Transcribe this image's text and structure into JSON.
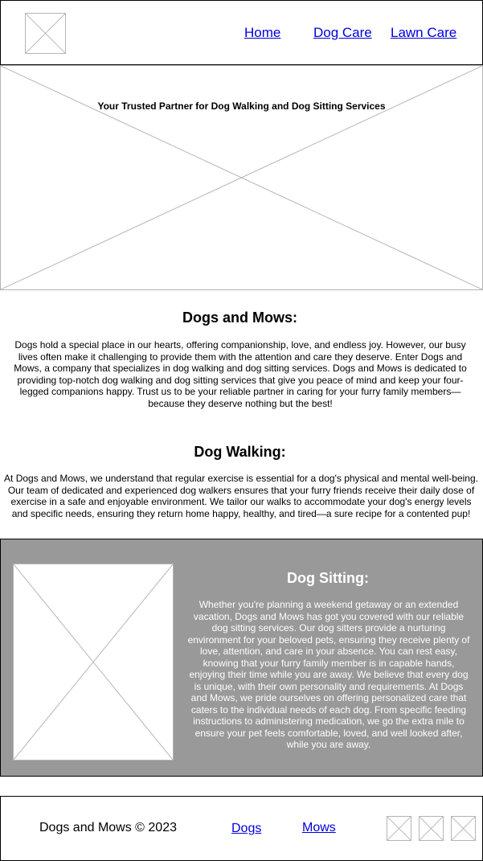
{
  "header": {
    "logo_icon": "image-placeholder-icon",
    "nav": [
      {
        "label": "Home"
      },
      {
        "label": "Dog Care"
      },
      {
        "label": "Lawn Care"
      }
    ]
  },
  "hero": {
    "image_icon": "image-placeholder-icon",
    "tagline": "Your Trusted Partner for Dog Walking and Dog Sitting Services"
  },
  "intro": {
    "heading": "Dogs and Mows:",
    "body": "Dogs hold a special place in our hearts, offering companionship, love, and endless joy. However, our busy lives often make it challenging to provide them with the attention and care they deserve. Enter Dogs and Mows, a company that specializes in dog walking and dog sitting services. Dogs and Mows is dedicated to providing top-notch dog walking and dog sitting services that give you peace of mind and keep your four-legged companions happy. Trust us to be your reliable partner in caring for your furry family members—because they deserve nothing but the best!"
  },
  "walking": {
    "heading": "Dog Walking:",
    "body": "At Dogs and Mows, we understand that regular exercise is essential for a dog's physical and mental well-being. Our team of dedicated and experienced dog walkers ensures that your furry friends receive their daily dose of exercise in a safe and enjoyable environment. We tailor our walks to accommodate your dog's energy levels and specific needs, ensuring they return home happy, healthy, and tired—a sure recipe for a contented pup!"
  },
  "sitting": {
    "heading": "Dog Sitting:",
    "image_icon": "image-placeholder-icon",
    "body": "Whether you're planning a weekend getaway or an extended vacation, Dogs and Mows has got you covered with our reliable dog sitting services. Our dog sitters provide a nurturing environment for your beloved pets, ensuring they receive plenty of love, attention, and care in your absence. You can rest easy, knowing that your furry family member is in capable hands, enjoying their time while you are away. We believe that every dog is unique, with their own personality and requirements. At Dogs and Mows, we pride ourselves on offering personalized care that caters to the individual needs of each dog. From specific feeding instructions to administering medication, we go the extra mile to ensure your pet feels comfortable, loved, and well looked after, while you are away.",
    "colors": {
      "panel_bg": "#999999",
      "text": "#ffffff"
    }
  },
  "footer": {
    "copyright": "Dogs and Mows © 2023",
    "links": [
      {
        "label": "Dogs"
      },
      {
        "label": "Mows"
      }
    ],
    "social_icons": [
      "image-placeholder-icon",
      "image-placeholder-icon",
      "image-placeholder-icon"
    ]
  },
  "colors": {
    "link": "#0000dd",
    "border": "#b4b4b4",
    "frame": "#000000"
  }
}
